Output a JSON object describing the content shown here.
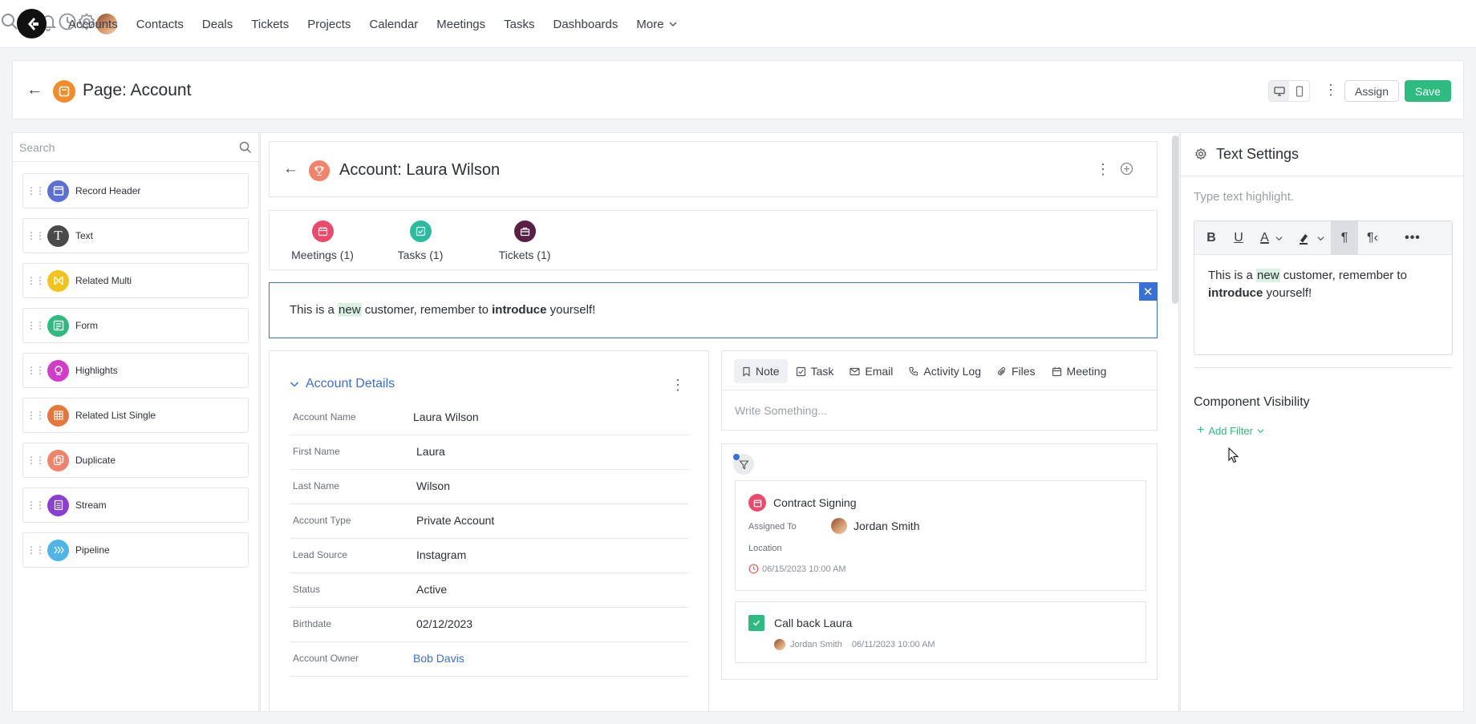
{
  "nav": {
    "links": [
      "Accounts",
      "Contacts",
      "Deals",
      "Tickets",
      "Projects",
      "Calendar",
      "Meetings",
      "Tasks",
      "Dashboards"
    ],
    "more_label": "More",
    "icons": [
      "search-icon",
      "help-icon",
      "bell-icon",
      "clock-icon",
      "gear-icon"
    ]
  },
  "page": {
    "title": "Page: Account",
    "assign_label": "Assign",
    "save_label": "Save"
  },
  "left_panel": {
    "search_placeholder": "Search",
    "components": [
      {
        "label": "Record Header",
        "color": "#5b6fd6"
      },
      {
        "label": "Text",
        "color": "#4a4a4a"
      },
      {
        "label": "Related Multi",
        "color": "#f2c318"
      },
      {
        "label": "Form",
        "color": "#2dbb7f"
      },
      {
        "label": "Highlights",
        "color": "#d23cc8"
      },
      {
        "label": "Related List Single",
        "color": "#e5773a"
      },
      {
        "label": "Duplicate",
        "color": "#f0836a"
      },
      {
        "label": "Stream",
        "color": "#8a3fd1"
      },
      {
        "label": "Pipeline",
        "color": "#4db5e8"
      }
    ]
  },
  "record": {
    "title": "Account: Laura Wilson",
    "tabs": [
      {
        "label": "Meetings (1)",
        "color": "#ec4a6b"
      },
      {
        "label": "Tasks (1)",
        "color": "#2dbb9f"
      },
      {
        "label": "Tickets (1)",
        "color": "#5a1f45"
      }
    ],
    "highlight": {
      "before": "This is a ",
      "marked": "new",
      "middle": " customer, remember to ",
      "bold": "introduce",
      "after": " yourself!"
    },
    "details": {
      "title": "Account Details",
      "fields": [
        {
          "label": "Account Name",
          "value": "Laura Wilson"
        },
        {
          "label": "First Name",
          "value": "Laura"
        },
        {
          "label": "Last Name",
          "value": "Wilson"
        },
        {
          "label": "Account Type",
          "value": "Private Account"
        },
        {
          "label": "Lead Source",
          "value": "Instagram"
        },
        {
          "label": "Status",
          "value": "Active"
        },
        {
          "label": "Birthdate",
          "value": "02/12/2023"
        },
        {
          "label": "Account Owner",
          "value": "Bob Davis"
        }
      ]
    },
    "note_tabs": [
      "Note",
      "Task",
      "Email",
      "Activity Log",
      "Files",
      "Meeting"
    ],
    "note_placeholder": "Write Something...",
    "activities": {
      "meeting": {
        "title": "Contract Signing",
        "assigned_label": "Assigned To",
        "assigned_to": "Jordan Smith",
        "location_label": "Location",
        "datetime": "06/15/2023 10:00 AM"
      },
      "task": {
        "title": "Call back Laura",
        "owner": "Jordan Smith",
        "datetime": "06/11/2023 10:00 AM"
      }
    }
  },
  "right_panel": {
    "title": "Text Settings",
    "highlight_placeholder": "Type text highlight.",
    "editor": {
      "before": "This is a ",
      "marked": "new",
      "middle": " customer, remember to ",
      "bold": "introduce",
      "after": " yourself!"
    },
    "visibility_title": "Component Visibility",
    "add_filter_label": "Add Filter"
  }
}
